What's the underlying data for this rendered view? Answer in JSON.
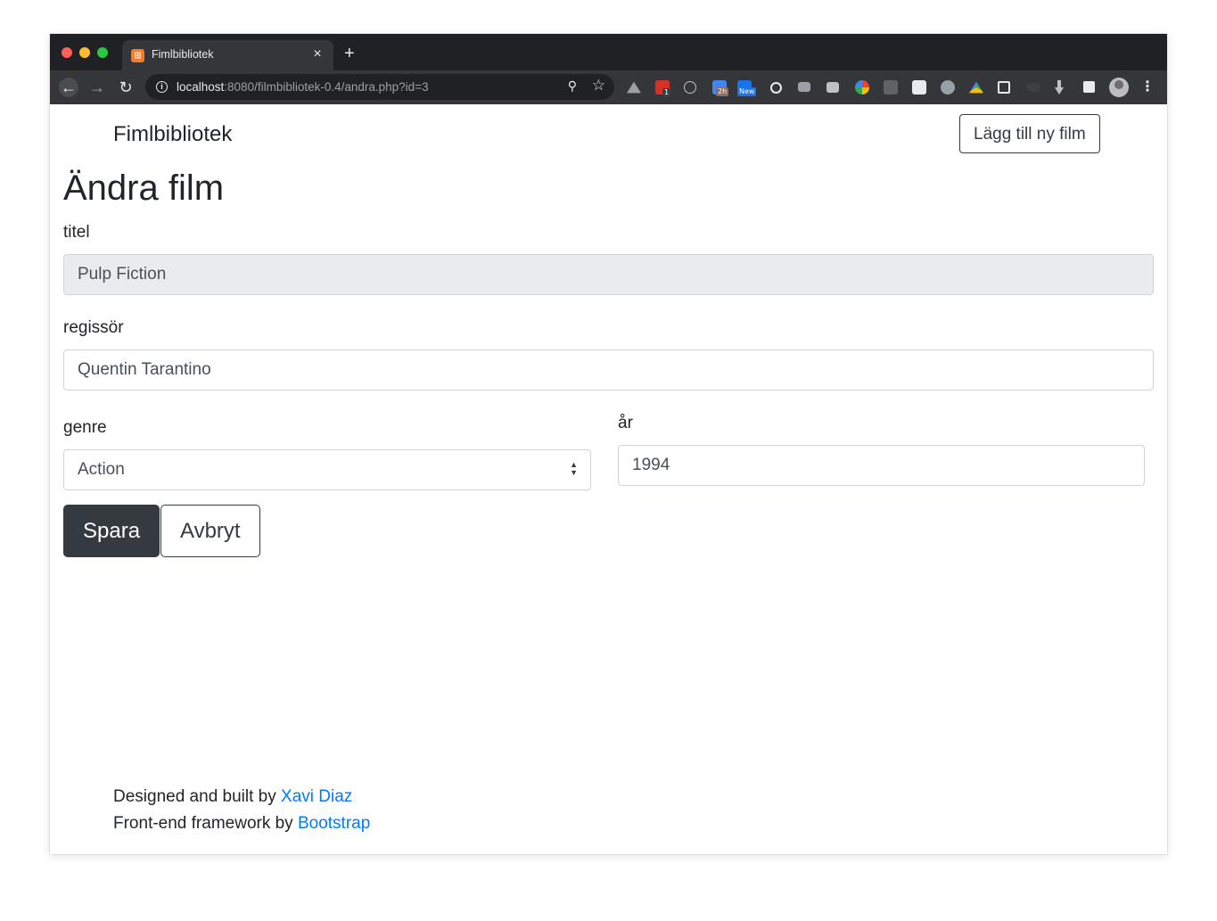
{
  "browser": {
    "tab_title": "Fimlbibliotek",
    "tab_favicon_glyph": "⊞",
    "tab_close": "×",
    "new_tab": "+",
    "url_host": "localhost",
    "url_path": ":8080/filmbibliotek-0.4/andra.php?id=3",
    "extension_badges": {
      "ext1": "1",
      "ext2": "2h",
      "ext3": "New"
    }
  },
  "navbar": {
    "brand": "Fimlbibliotek",
    "add_button": "Lägg till ny film"
  },
  "form": {
    "heading": "Ändra film",
    "title_label": "titel",
    "title_value": "Pulp Fiction",
    "director_label": "regissör",
    "director_value": "Quentin Tarantino",
    "genre_label": "genre",
    "genre_value": "Action",
    "year_label": "år",
    "year_value": "1994",
    "save_button": "Spara",
    "cancel_button": "Avbryt"
  },
  "footer": {
    "line1_prefix": "Designed and built by ",
    "line1_link": "Xavi Diaz",
    "line2_prefix": "Front-end framework by ",
    "line2_link": "Bootstrap"
  },
  "colors": {
    "accent_dark": "#343a40",
    "link": "#007bff",
    "readonly_bg": "#e9ecef"
  }
}
